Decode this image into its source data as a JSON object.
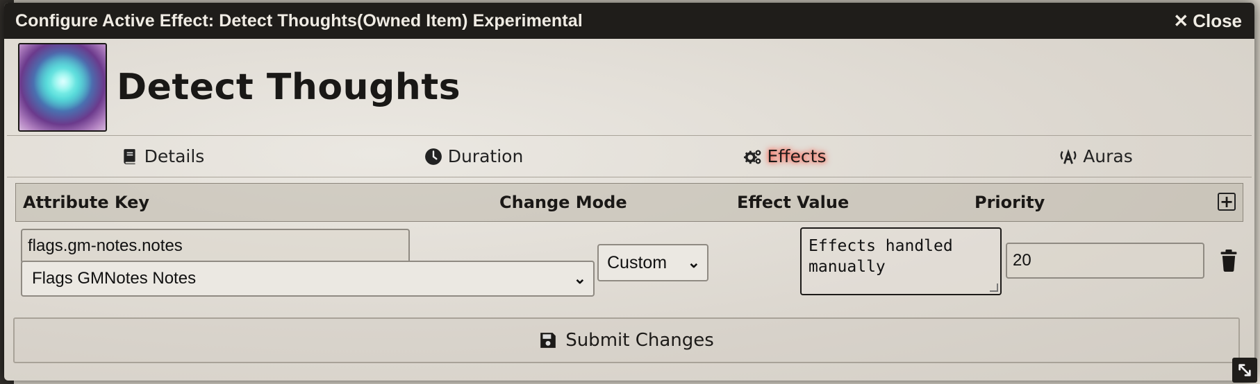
{
  "window": {
    "title": "Configure Active Effect: Detect Thoughts(Owned Item) Experimental",
    "close_label": "Close"
  },
  "effect": {
    "name": "Detect Thoughts",
    "icon": "detect-thoughts-portrait"
  },
  "tabs": [
    {
      "label": "Details",
      "icon": "book-icon",
      "active": false
    },
    {
      "label": "Duration",
      "icon": "clock-icon",
      "active": false
    },
    {
      "label": "Effects",
      "icon": "cogs-icon",
      "active": true
    },
    {
      "label": "Auras",
      "icon": "broadcast-icon",
      "active": false
    }
  ],
  "changes": {
    "headers": {
      "attribute_key": "Attribute Key",
      "change_mode": "Change Mode",
      "effect_value": "Effect Value",
      "priority": "Priority"
    },
    "rows": [
      {
        "key": "flags.gm-notes.notes",
        "key_select": "Flags GMNotes Notes",
        "mode": "Custom",
        "value": "Effects handled\nmanually",
        "priority": "20"
      }
    ]
  },
  "submit_label": "Submit Changes",
  "colors": {
    "titlebar": "#1f1d1a",
    "active_tab_glow": "#ff4a3a"
  }
}
